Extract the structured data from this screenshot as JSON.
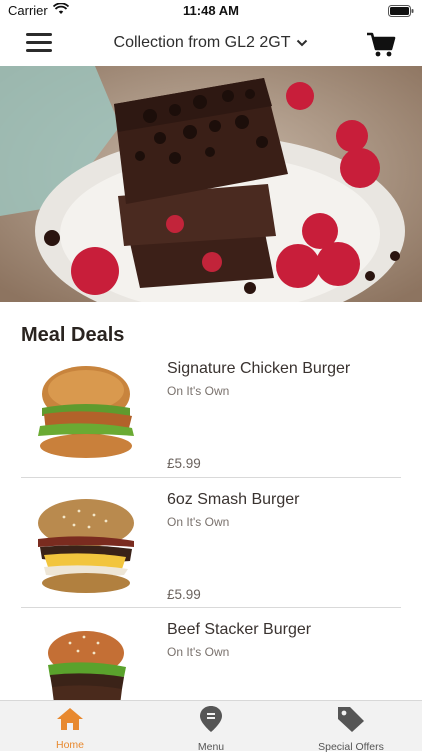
{
  "status_bar": {
    "carrier": "Carrier",
    "time": "11:48 AM"
  },
  "nav": {
    "title": "Collection from GL2 2GT"
  },
  "section": {
    "title": "Meal Deals"
  },
  "items": [
    {
      "name": "Signature Chicken Burger",
      "sub": "On It's Own",
      "price": "£5.99"
    },
    {
      "name": "6oz Smash Burger",
      "sub": "On It's Own",
      "price": "£5.99"
    },
    {
      "name": "Beef Stacker Burger",
      "sub": "On It's Own"
    }
  ],
  "tabs": [
    {
      "label": "Home",
      "icon": "home-icon"
    },
    {
      "label": "Menu",
      "icon": "map-pin-icon"
    },
    {
      "label": "Special Offers",
      "icon": "tag-icon"
    }
  ],
  "colors": {
    "accent": "#e8892f",
    "tab_inactive": "#555555",
    "text_dark": "#2a2420"
  }
}
